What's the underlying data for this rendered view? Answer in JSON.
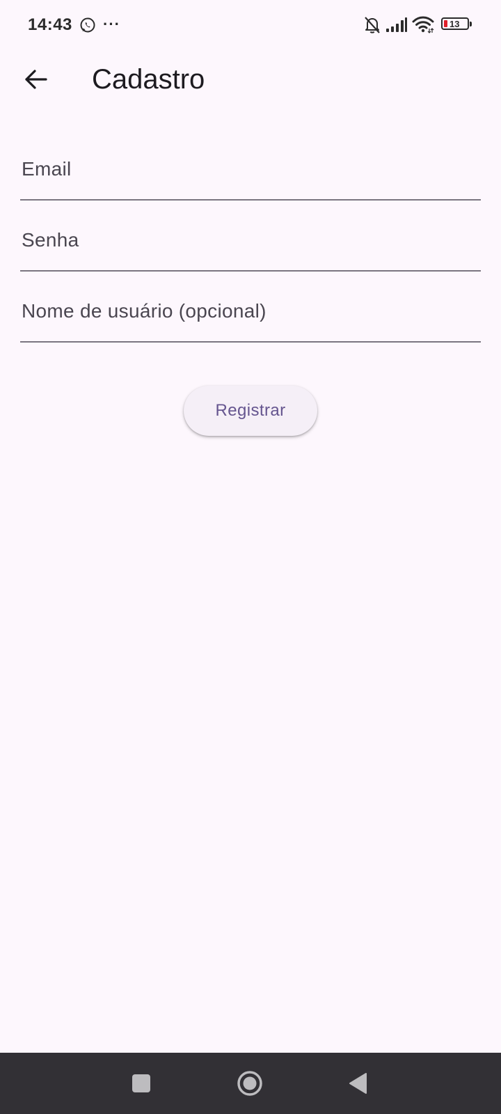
{
  "status_bar": {
    "time": "14:43",
    "more_indicator": "···",
    "battery_level": "13",
    "battery_fill_color": "#e0202a",
    "icons": [
      "whatsapp-icon",
      "bell-off-icon",
      "signal-icon",
      "wifi-icon",
      "battery-icon"
    ]
  },
  "app_bar": {
    "title": "Cadastro",
    "back_icon": "arrow-left-icon"
  },
  "form": {
    "email": {
      "placeholder": "Email",
      "value": ""
    },
    "senha": {
      "placeholder": "Senha",
      "value": ""
    },
    "nome": {
      "placeholder": "Nome de usuário (opcional)",
      "value": ""
    },
    "register_label": "Registrar"
  },
  "nav_bar": {
    "icons": [
      "square-recents-icon",
      "circle-home-icon",
      "triangle-back-icon"
    ]
  },
  "colors": {
    "background": "#fdf7fd",
    "accent": "#65558f",
    "button_bg": "#f5eff7",
    "nav_bar": "#323035"
  }
}
